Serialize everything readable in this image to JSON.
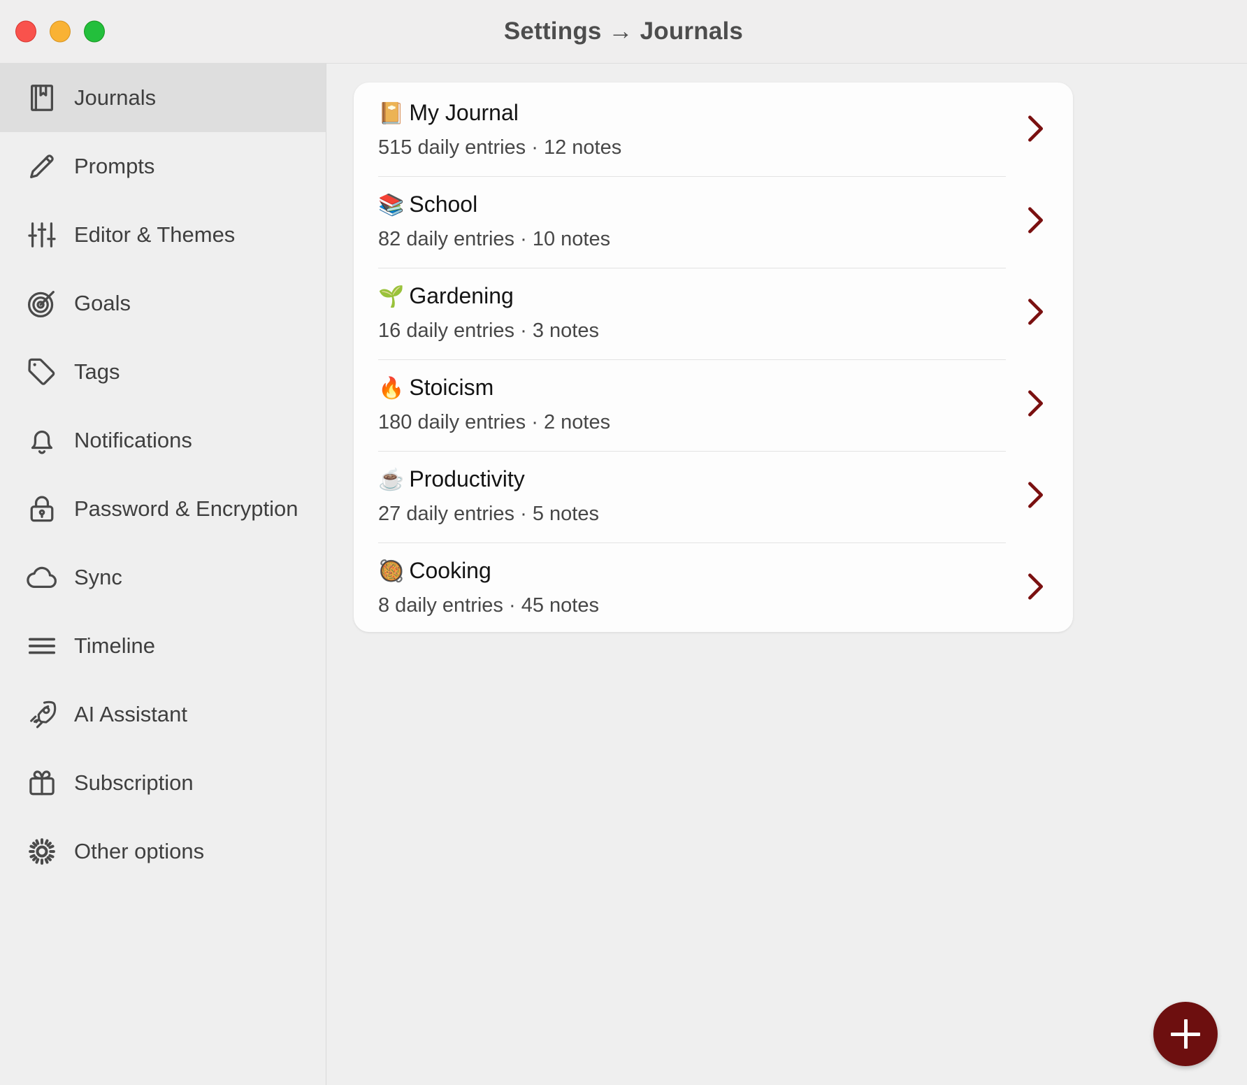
{
  "window": {
    "title": "Settings → Journals",
    "traffic_lights": {
      "close": "close",
      "minimize": "minimize",
      "maximize": "maximize"
    }
  },
  "sidebar": {
    "items": [
      {
        "label": "Journals",
        "icon": "journal-icon",
        "active": true
      },
      {
        "label": "Prompts",
        "icon": "pencil-icon",
        "active": false
      },
      {
        "label": "Editor & Themes",
        "icon": "sliders-icon",
        "active": false
      },
      {
        "label": "Goals",
        "icon": "target-icon",
        "active": false
      },
      {
        "label": "Tags",
        "icon": "tag-icon",
        "active": false
      },
      {
        "label": "Notifications",
        "icon": "bell-icon",
        "active": false
      },
      {
        "label": "Password & Encryption",
        "icon": "lock-icon",
        "active": false
      },
      {
        "label": "Sync",
        "icon": "cloud-icon",
        "active": false
      },
      {
        "label": "Timeline",
        "icon": "timeline-icon",
        "active": false
      },
      {
        "label": "AI Assistant",
        "icon": "rocket-icon",
        "active": false
      },
      {
        "label": "Subscription",
        "icon": "gift-icon",
        "active": false
      },
      {
        "label": "Other options",
        "icon": "gear-icon",
        "active": false
      }
    ]
  },
  "main": {
    "journals": [
      {
        "emoji": "📔",
        "name": "My Journal",
        "stats": "515 daily entries · 12 notes"
      },
      {
        "emoji": "📚",
        "name": "School",
        "stats": "82 daily entries · 10 notes"
      },
      {
        "emoji": "🌱",
        "name": "Gardening",
        "stats": "16 daily entries · 3 notes"
      },
      {
        "emoji": "🔥",
        "name": "Stoicism",
        "stats": "180 daily entries · 2 notes"
      },
      {
        "emoji": "☕",
        "name": "Productivity",
        "stats": "27 daily entries · 5 notes"
      },
      {
        "emoji": "🥘",
        "name": "Cooking",
        "stats": "8 daily entries · 45 notes"
      }
    ],
    "add_button_label": "+",
    "chevron_icon": "chevron-right-icon"
  },
  "colors": {
    "accent": "#6d0f0f",
    "chevron": "#7a1010",
    "sidebar_bg": "#efefef",
    "sidebar_active_bg": "#dedede",
    "card_bg": "#fdfdfd",
    "title_text": "#4d4d4d"
  }
}
